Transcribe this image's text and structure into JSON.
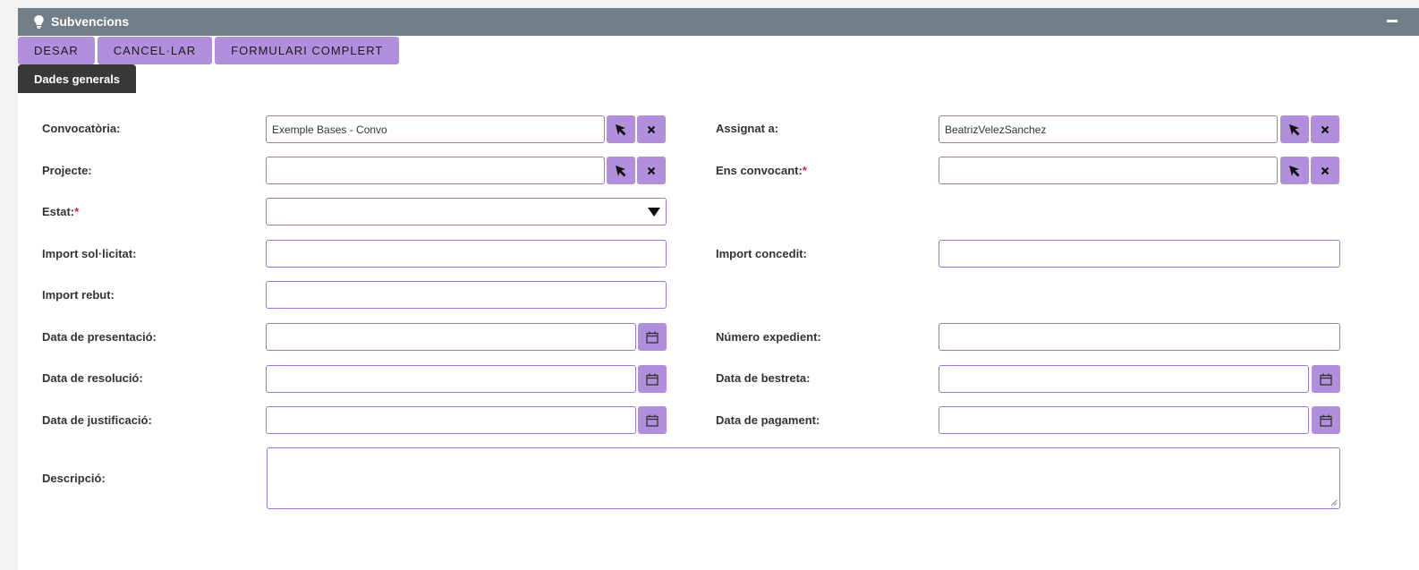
{
  "panel": {
    "title": "Subvencions",
    "icon": "lightbulb-icon",
    "header_color": "#717e87"
  },
  "actions": {
    "save": "DESAR",
    "cancel": "CANCEL·LAR",
    "full_form": "FORMULARI COMPLERT"
  },
  "tabs": [
    {
      "label": "Dades generals",
      "active": true
    }
  ],
  "accent_color": "#b28fdd",
  "form": {
    "convocatoria": {
      "label": "Convocatòria:",
      "value": "Exemple Bases - Convo"
    },
    "assignat": {
      "label": "Assignat a:",
      "value": "BeatrizVelezSanchez"
    },
    "projecte": {
      "label": "Projecte:",
      "value": ""
    },
    "ens_convocant": {
      "label": "Ens convocant:",
      "required": "*",
      "value": ""
    },
    "estat": {
      "label": "Estat:",
      "required": "*",
      "value": ""
    },
    "import_sollicitat": {
      "label": "Import sol·licitat:",
      "value": ""
    },
    "import_concedit": {
      "label": "Import concedit:",
      "value": ""
    },
    "import_rebut": {
      "label": "Import rebut:",
      "value": ""
    },
    "data_presentacio": {
      "label": "Data de presentació:",
      "value": ""
    },
    "numero_expedient": {
      "label": "Número expedient:",
      "value": ""
    },
    "data_resolucio": {
      "label": "Data de resolució:",
      "value": ""
    },
    "data_bestreta": {
      "label": "Data de bestreta:",
      "value": ""
    },
    "data_justificacio": {
      "label": "Data de justificació:",
      "value": ""
    },
    "data_pagament": {
      "label": "Data de pagament:",
      "value": ""
    },
    "descripcio": {
      "label": "Descripció:",
      "value": ""
    }
  }
}
